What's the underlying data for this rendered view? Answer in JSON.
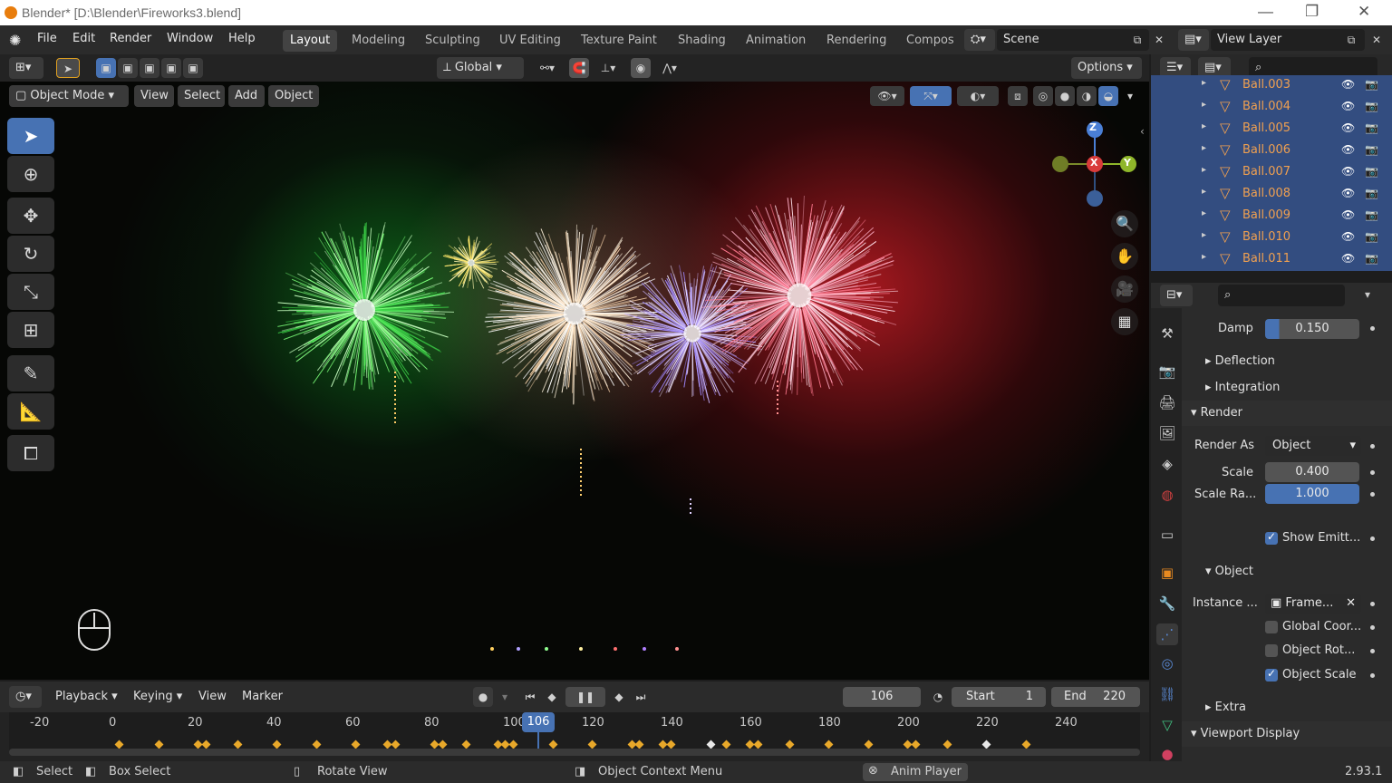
{
  "window": {
    "title": "Blender* [D:\\Blender\\Fireworks3.blend]",
    "min": "—",
    "max": "❐",
    "close": "✕"
  },
  "menu": {
    "items": [
      "File",
      "Edit",
      "Render",
      "Window",
      "Help"
    ]
  },
  "workspaces": [
    "Layout",
    "Modeling",
    "Sculpting",
    "UV Editing",
    "Texture Paint",
    "Shading",
    "Animation",
    "Rendering",
    "Compos"
  ],
  "scene": {
    "label": "Scene"
  },
  "viewlayer": {
    "label": "View Layer"
  },
  "toolbar": {
    "orientation": "Global",
    "options": "Options"
  },
  "viewport_header": {
    "mode": "Object Mode",
    "view": "View",
    "select": "Select",
    "add": "Add",
    "object": "Object"
  },
  "gizmo": {
    "z": "Z",
    "y": "Y",
    "x": "X"
  },
  "outliner": {
    "items": [
      "Ball.003",
      "Ball.004",
      "Ball.005",
      "Ball.006",
      "Ball.007",
      "Ball.008",
      "Ball.009",
      "Ball.010",
      "Ball.011"
    ]
  },
  "properties": {
    "damp_label": "Damp",
    "damp_value": "0.150",
    "deflection": "Deflection",
    "integration": "Integration",
    "render": "Render",
    "render_as_label": "Render As",
    "render_as_value": "Object",
    "scale_label": "Scale",
    "scale_value": "0.400",
    "scale_random_label": "Scale Ra...",
    "scale_random_value": "1.000",
    "show_emitter": "Show Emitt...",
    "object": "Object",
    "instance_label": "Instance ...",
    "instance_value": "Frame...",
    "global_coord": "Global Coor...",
    "object_rot": "Object Rot...",
    "object_scale": "Object Scale",
    "extra": "Extra",
    "viewport_display": "Viewport Display"
  },
  "timeline": {
    "playback": "Playback",
    "keying": "Keying",
    "view": "View",
    "marker": "Marker",
    "current_frame": "106",
    "start_label": "Start",
    "start_value": "1",
    "end_label": "End",
    "end_value": "220",
    "ticks": [
      "-20",
      "0",
      "20",
      "40",
      "60",
      "80",
      "100",
      "120",
      "140",
      "160",
      "180",
      "200",
      "220",
      "240"
    ],
    "playhead": "106"
  },
  "statusbar": {
    "select": "Select",
    "box_select": "Box Select",
    "rotate": "Rotate View",
    "context": "Object Context Menu",
    "anim": "Anim Player",
    "version": "2.93.1"
  }
}
